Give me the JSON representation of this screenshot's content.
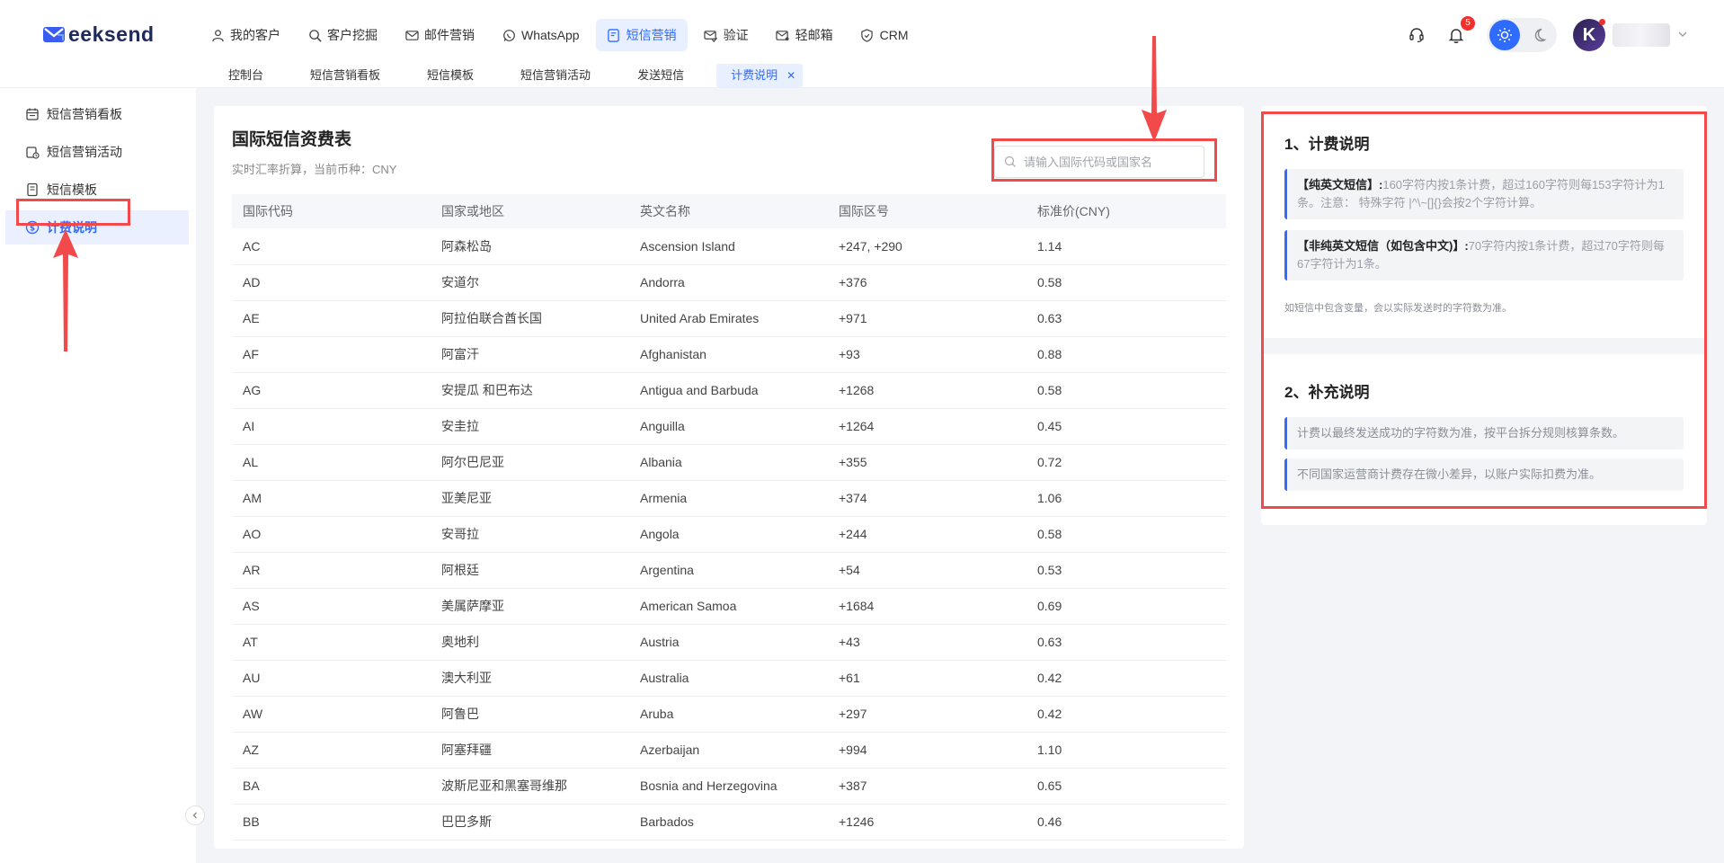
{
  "brand": {
    "name": "eeksend"
  },
  "topnav": [
    {
      "label": "我的客户",
      "icon": "user-icon"
    },
    {
      "label": "客户挖掘",
      "icon": "search-icon"
    },
    {
      "label": "邮件营销",
      "icon": "mail-icon"
    },
    {
      "label": "WhatsApp",
      "icon": "whatsapp-icon"
    },
    {
      "label": "短信营销",
      "icon": "sms-icon",
      "active": true
    },
    {
      "label": "验证",
      "icon": "verify-mail-icon"
    },
    {
      "label": "轻邮箱",
      "icon": "light-mail-icon"
    },
    {
      "label": "CRM",
      "icon": "shield-icon"
    }
  ],
  "subtabs": [
    {
      "label": "控制台"
    },
    {
      "label": "短信营销看板"
    },
    {
      "label": "短信模板"
    },
    {
      "label": "短信营销活动"
    },
    {
      "label": "发送短信"
    },
    {
      "label": "计费说明",
      "active": true,
      "closable": true
    }
  ],
  "header": {
    "notification_count": "5",
    "avatar_letter": "K"
  },
  "sidebar": {
    "items": [
      {
        "label": "短信营销看板",
        "icon": "calendar-icon"
      },
      {
        "label": "短信营销活动",
        "icon": "campaign-icon"
      },
      {
        "label": "短信模板",
        "icon": "template-icon"
      },
      {
        "label": "计费说明",
        "icon": "dollar-icon",
        "active": true
      }
    ]
  },
  "main": {
    "title": "国际短信资费表",
    "subtitle": "实时汇率折算，当前币种：CNY",
    "search_placeholder": "请输入国际代码或国家名",
    "columns": [
      "国际代码",
      "国家或地区",
      "英文名称",
      "国际区号",
      "标准价(CNY)"
    ],
    "rows": [
      [
        "AC",
        "阿森松岛",
        "Ascension Island",
        "+247, +290",
        "1.14"
      ],
      [
        "AD",
        "安道尔",
        "Andorra",
        "+376",
        "0.58"
      ],
      [
        "AE",
        "阿拉伯联合酋长国",
        "United Arab Emirates",
        "+971",
        "0.63"
      ],
      [
        "AF",
        "阿富汗",
        "Afghanistan",
        "+93",
        "0.88"
      ],
      [
        "AG",
        "安提瓜 和巴布达",
        "Antigua and Barbuda",
        "+1268",
        "0.58"
      ],
      [
        "AI",
        "安圭拉",
        "Anguilla",
        "+1264",
        "0.45"
      ],
      [
        "AL",
        "阿尔巴尼亚",
        "Albania",
        "+355",
        "0.72"
      ],
      [
        "AM",
        "亚美尼亚",
        "Armenia",
        "+374",
        "1.06"
      ],
      [
        "AO",
        "安哥拉",
        "Angola",
        "+244",
        "0.58"
      ],
      [
        "AR",
        "阿根廷",
        "Argentina",
        "+54",
        "0.53"
      ],
      [
        "AS",
        "美属萨摩亚",
        "American Samoa",
        "+1684",
        "0.69"
      ],
      [
        "AT",
        "奥地利",
        "Austria",
        "+43",
        "0.63"
      ],
      [
        "AU",
        "澳大利亚",
        "Australia",
        "+61",
        "0.42"
      ],
      [
        "AW",
        "阿鲁巴",
        "Aruba",
        "+297",
        "0.42"
      ],
      [
        "AZ",
        "阿塞拜疆",
        "Azerbaijan",
        "+994",
        "1.10"
      ],
      [
        "BA",
        "波斯尼亚和黑塞哥维那",
        "Bosnia and Herzegovina",
        "+387",
        "0.65"
      ],
      [
        "BB",
        "巴巴多斯",
        "Barbados",
        "+1246",
        "0.46"
      ]
    ]
  },
  "billing": {
    "section1_title": "1、计费说明",
    "note1_label": "【纯英文短信】:",
    "note1_text": "160字符内按1条计费，超过160字符则每153字符计为1条。注意： 特殊字符 |^\\~[]{}会按2个字符计算。",
    "note2_label": "【非纯英文短信（如包含中文)】:",
    "note2_text": "70字符内按1条计费，超过70字符则每67字符计为1条。",
    "tip": "如短信中包含变量，会以实际发送时的字符数为准。",
    "section2_title": "2、补充说明",
    "note3_text": "计费以最终发送成功的字符数为准，按平台拆分规则核算条数。",
    "note4_text": "不同国家运营商计费存在微小差异，以账户实际扣费为准。"
  },
  "colors": {
    "accent": "#2f6bff",
    "annotation": "#f24a4a",
    "badge": "#f0312b"
  }
}
